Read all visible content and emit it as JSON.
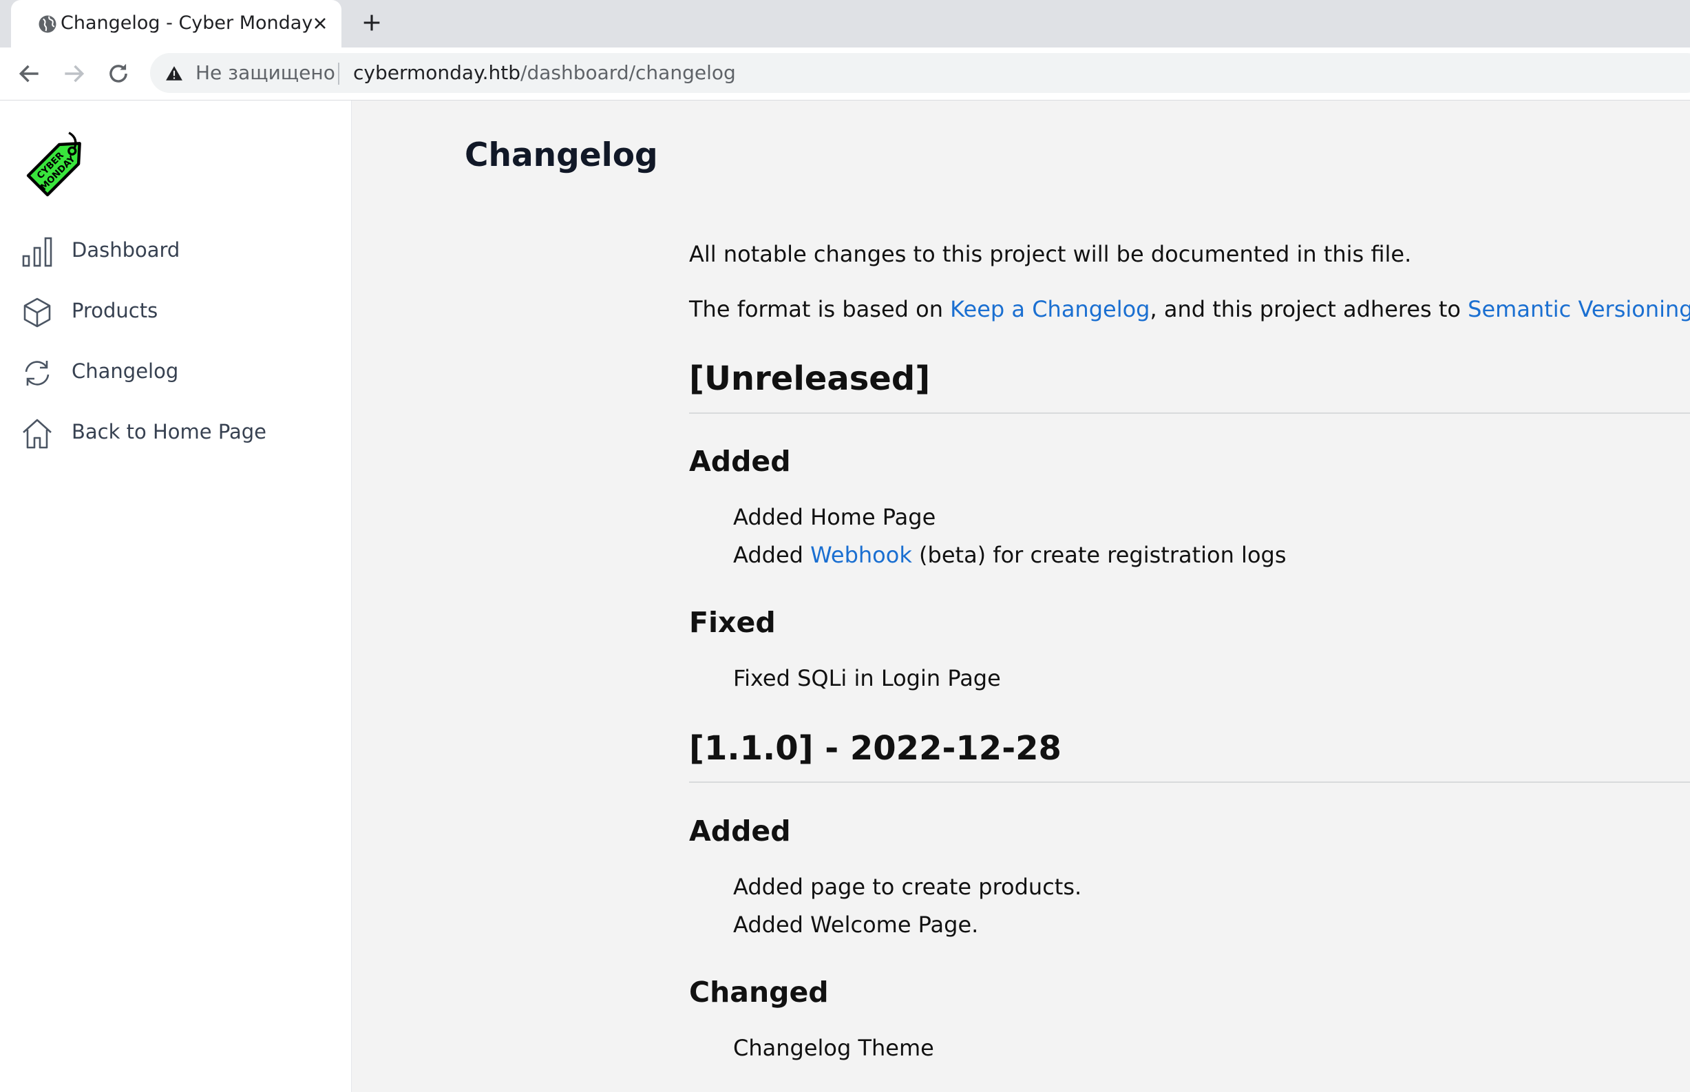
{
  "browser": {
    "tab_title": "Changelog - Cyber Monday",
    "not_secure_label": "Не защищено",
    "url_host": "cybermonday.htb",
    "url_path": "/dashboard/changelog"
  },
  "logo": {
    "text_line1": "CYBER",
    "text_line2": "MONDAY",
    "color": "#39e63c"
  },
  "sidebar": {
    "items": [
      {
        "label": "Dashboard",
        "icon": "bar-chart-icon"
      },
      {
        "label": "Products",
        "icon": "box-icon"
      },
      {
        "label": "Changelog",
        "icon": "refresh-icon"
      },
      {
        "label": "Back to Home Page",
        "icon": "home-icon"
      }
    ]
  },
  "main": {
    "title": "Changelog",
    "intro1": "All notable changes to this project will be documented in this file.",
    "intro2_prefix": "The format is based on ",
    "intro2_link1": "Keep a Changelog",
    "intro2_mid": ", and this project adheres to ",
    "intro2_link2": "Semantic Versioning",
    "intro2_suffix": ".",
    "link_color": "#1a6fd1",
    "unreleased": {
      "heading": "[Unreleased]",
      "added_heading": "Added",
      "added_item1": "Added Home Page",
      "added_item2_prefix": "Added ",
      "added_item2_link": "Webhook",
      "added_item2_suffix": " (beta) for create registration logs",
      "fixed_heading": "Fixed",
      "fixed_item1": "Fixed SQLi in Login Page"
    },
    "v110": {
      "heading": "[1.1.0] - 2022-12-28",
      "added_heading": "Added",
      "added_item1": "Added page to create products.",
      "added_item2": "Added Welcome Page.",
      "changed_heading": "Changed",
      "changed_item1": "Changelog Theme"
    }
  }
}
